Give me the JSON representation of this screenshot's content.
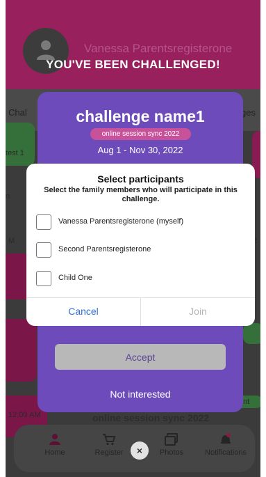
{
  "background": {
    "user_name": "Vanessa Parentsregisterone",
    "tabs": [
      "Chal",
      "ges"
    ],
    "labels": {
      "test": "test 1",
      "side_letter": "M",
      "side_num": "2",
      "side_left": "n",
      "time": "12:00 AM",
      "tag": "ent"
    },
    "event_title": "online session sync 2022",
    "nav": [
      {
        "label": "Home",
        "icon": "home-icon"
      },
      {
        "label": "Register",
        "icon": "cart-icon"
      },
      {
        "label": "Photos",
        "icon": "photos-icon"
      },
      {
        "label": "Notifications",
        "icon": "bell-icon"
      }
    ]
  },
  "challenge": {
    "banner": "YOU'VE BEEN CHALLENGED!",
    "name": "challenge name1",
    "badge": "online session sync 2022",
    "dates": "Aug 1 - Nov 30, 2022",
    "accept_label": "Accept",
    "decline_label": "Not interested"
  },
  "dialog": {
    "title": "Select participants",
    "description": "Select the family members who will participate in this challenge.",
    "options": [
      {
        "label": "Vanessa Parentsregisterone (myself)",
        "checked": false
      },
      {
        "label": "Second Parentsregisterone",
        "checked": false
      },
      {
        "label": "Child One",
        "checked": false
      }
    ],
    "cancel_label": "Cancel",
    "join_label": "Join"
  },
  "close_glyph": "×",
  "colors": {
    "card_purple": "#6d4bbb",
    "badge_pink": "#c8529a",
    "cancel_blue": "#2e6fd6",
    "join_disabled": "#b5b5b5",
    "header_magenta": "#98205c"
  }
}
